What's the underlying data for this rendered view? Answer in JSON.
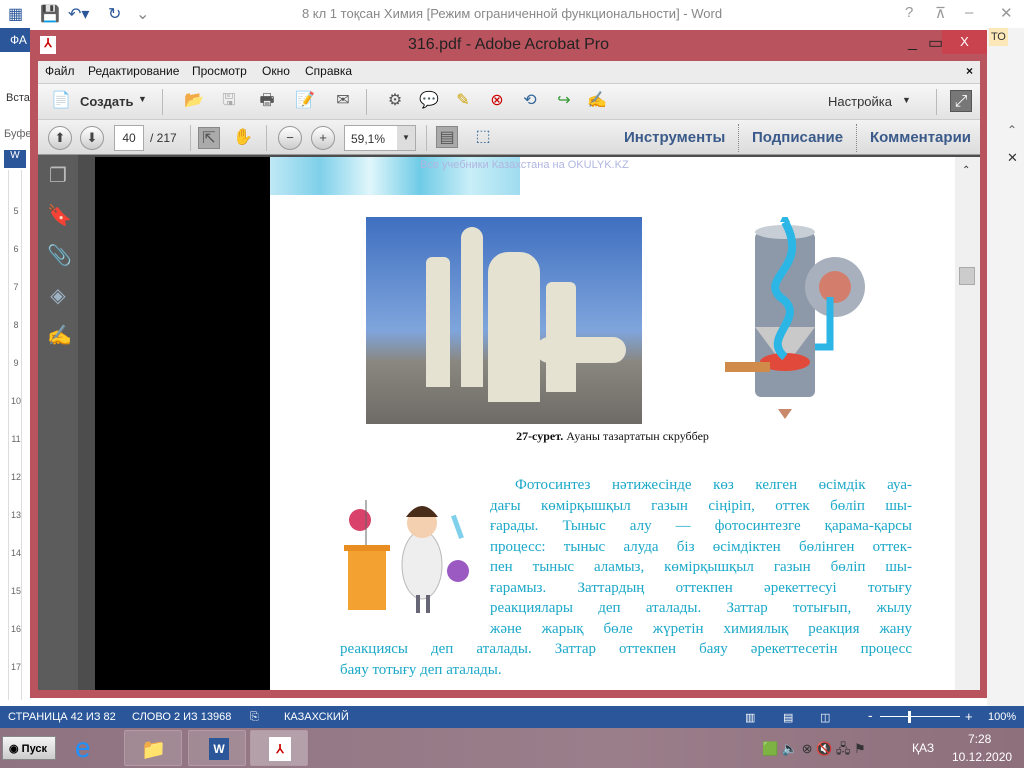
{
  "word": {
    "title": "8 кл 1 тоқсан Химия [Режим ограниченной функциональности] - Word",
    "tab_file": "ФА",
    "help": "?",
    "ribbon_partial_left": "Вста",
    "buffer_partial": "Буфе",
    "right_partial": "ТО",
    "ruler_numbers": [
      "5",
      "6",
      "7",
      "8",
      "9",
      "10",
      "11",
      "12",
      "13",
      "14",
      "15",
      "16",
      "17"
    ]
  },
  "acrobat": {
    "title": "316.pdf - Adobe Acrobat Pro",
    "close_label": "X",
    "menu": [
      "Файл",
      "Редактирование",
      "Просмотр",
      "Окно",
      "Справка"
    ],
    "create_label": "Создать",
    "customize_label": "Настройка",
    "page_current": "40",
    "page_total": "/ 217",
    "zoom_value": "59,1%",
    "panes": [
      "Инструменты",
      "Подписание",
      "Комментарии"
    ],
    "page": {
      "watermark": "Все учебники Казахстана на OKULYK.KZ",
      "caption_bold": "27-сурет.",
      "caption_text": " Ауаны тазартатын скруббер",
      "paragraph_lines": [
        "Фотосинтез нәтижесінде көз келген өсімдік ауа-",
        "дағы көмірқышқыл газын сіңіріп, оттек бөліп шы-",
        "ғарады. Тыныс алу — фотосинтезге қарама-қарсы",
        "процесс: тыныс алуда біз өсімдіктен бөлінген оттек-",
        "пен тыныс аламыз, көмірқышқыл газын бөліп шы-",
        "ғарамыз. Заттардың оттекпен әрекеттесуі тотығу",
        "реакциялары деп аталады. Заттар тотығып, жылу",
        "және жарық бөле жүретін химиялық реакция жану",
        "реакциясы деп аталады. Заттар оттекпен баяу әрекеттесетін процесс",
        "баяу тотығу деп аталады."
      ]
    }
  },
  "statusbar": {
    "page": "СТРАНИЦА 42 ИЗ 82",
    "words": "СЛОВО 2 ИЗ 13968",
    "language": "КАЗАХСКИЙ",
    "zoom": "100%"
  },
  "taskbar": {
    "start": "Пуск",
    "lang": "ҚАЗ",
    "time": "7:28",
    "date": "10.12.2020"
  },
  "colors": {
    "acrobat_frame": "#b9545f",
    "word_blue": "#2b579a",
    "text_cyan": "#1ba8c9"
  }
}
